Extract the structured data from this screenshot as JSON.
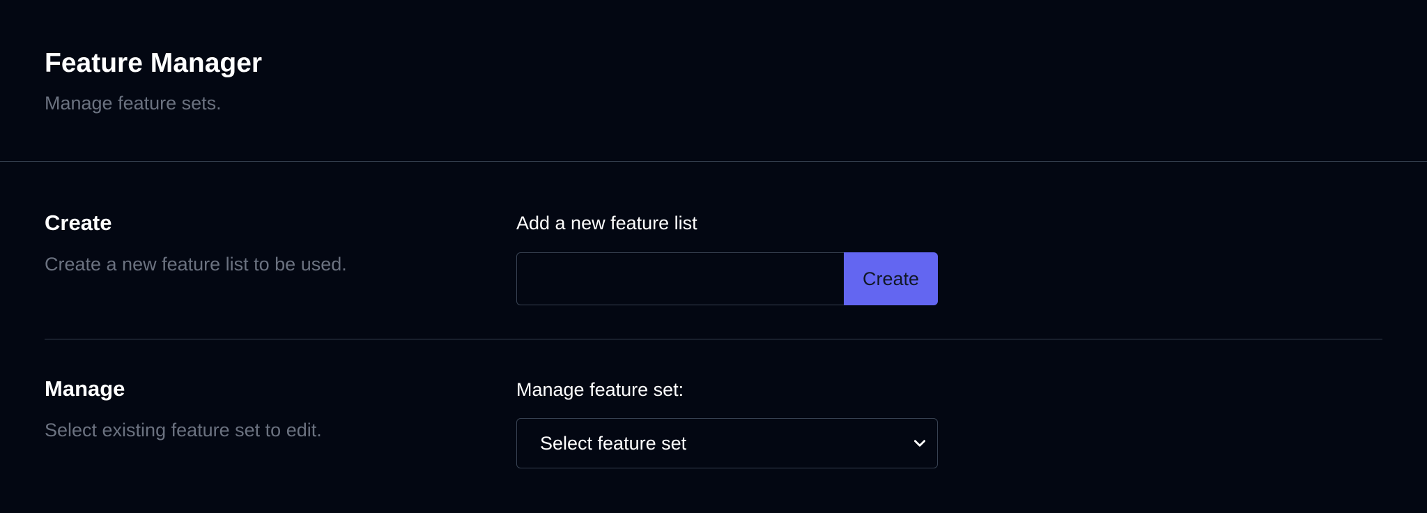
{
  "header": {
    "title": "Feature Manager",
    "subtitle": "Manage feature sets."
  },
  "create_section": {
    "title": "Create",
    "description": "Create a new feature list to be used.",
    "field_label": "Add a new feature list",
    "input_value": "",
    "input_placeholder": "",
    "button_label": "Create"
  },
  "manage_section": {
    "title": "Manage",
    "description": "Select existing feature set to edit.",
    "field_label": "Manage feature set:",
    "select_value": "Select feature set"
  },
  "colors": {
    "background": "#030712",
    "accent": "#6366f1",
    "muted_text": "#6b7280",
    "border": "#374151"
  },
  "icons": {
    "select_chevron": "chevron-down-icon"
  }
}
